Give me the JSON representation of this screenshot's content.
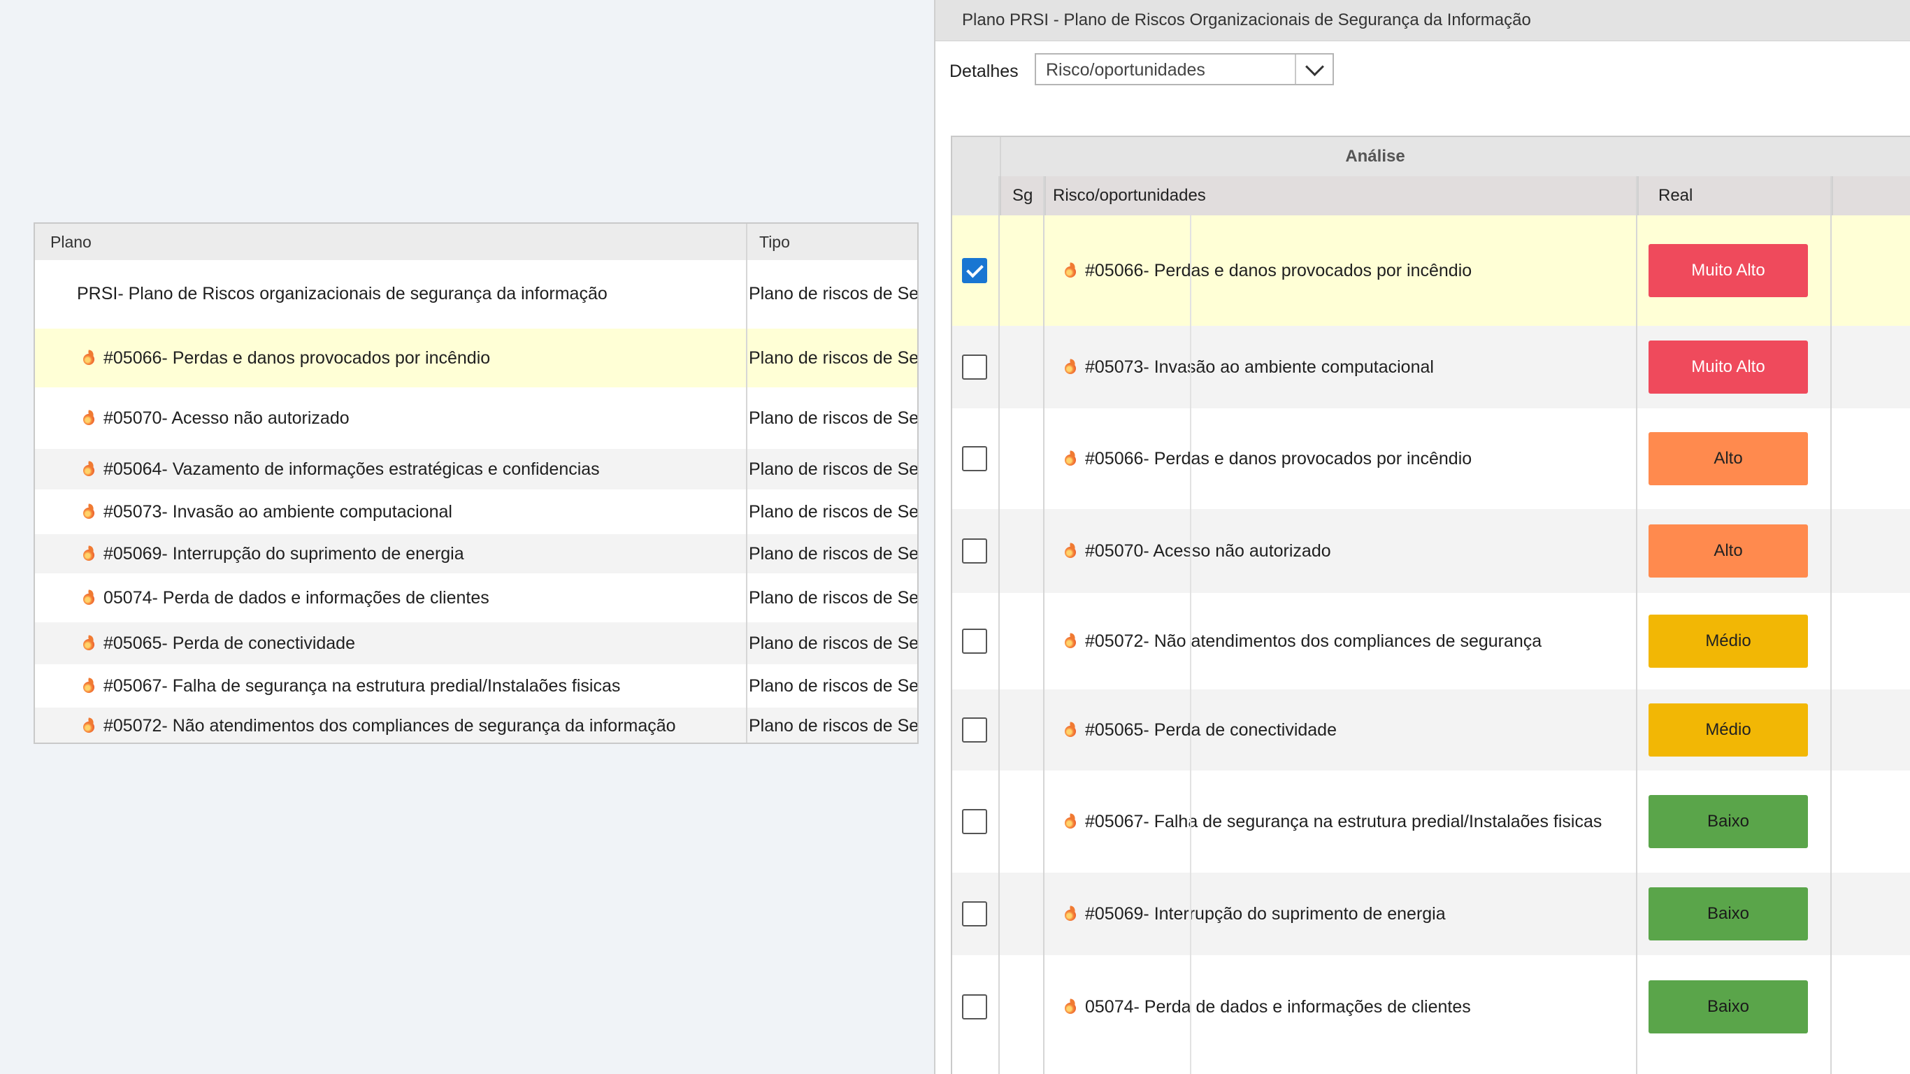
{
  "left_grid": {
    "columns": {
      "plano": "Plano",
      "tipo": "Tipo"
    },
    "rows": [
      {
        "plano": "PRSI- Plano de Riscos organizacionais de segurança da informação",
        "tipo": "Plano de riscos de Se",
        "icon": "",
        "indent": 0
      },
      {
        "plano": "#05066- Perdas e danos provocados por incêndio",
        "tipo": "Plano de riscos de Se",
        "icon": "flame-icon",
        "indent": 1,
        "highlight": true
      },
      {
        "plano": "#05070- Acesso não autorizado",
        "tipo": "Plano de riscos de Se",
        "icon": "flame-icon",
        "indent": 1
      },
      {
        "plano": "#05064- Vazamento de informações estratégicas e confidencias",
        "tipo": "Plano de riscos de Se",
        "icon": "flame-icon",
        "indent": 1
      },
      {
        "plano": "#05073- Invasão ao ambiente computacional",
        "tipo": "Plano de riscos de Se",
        "icon": "flame-icon",
        "indent": 1
      },
      {
        "plano": "#05069- Interrupção do suprimento de energia",
        "tipo": "Plano de riscos de Se",
        "icon": "flame-icon",
        "indent": 1
      },
      {
        "plano": "05074- Perda de dados e informações de clientes",
        "tipo": "Plano de riscos de Se",
        "icon": "flame-icon",
        "indent": 1
      },
      {
        "plano": "#05065- Perda de conectividade",
        "tipo": "Plano de riscos de Se",
        "icon": "flame-icon",
        "indent": 1
      },
      {
        "plano": "#05067- Falha de segurança na estrutura predial/Instalaões fisicas",
        "tipo": "Plano de riscos de Se",
        "icon": "flame-icon",
        "indent": 1
      },
      {
        "plano": "#05072-  Não atendimentos  dos compliances de segurança da informação",
        "tipo": "Plano de riscos de Se",
        "icon": "flame-icon",
        "indent": 1
      }
    ]
  },
  "window": {
    "title": "Plano PRSI - Plano de Riscos Organizacionais de Segurança da Informação",
    "detalhes_label": "Detalhes",
    "select_value": "Risco/oportunidades",
    "grid": {
      "group_header": "Análise",
      "columns": {
        "sg": "Sg",
        "risco": "Risco/oportunidades",
        "real": "Real"
      },
      "rows": [
        {
          "checked": true,
          "text": "#05066- Perdas e danos provocados por incêndio",
          "real": "Muito Alto",
          "level": "muito-alto",
          "highlight": true
        },
        {
          "checked": false,
          "text": "#05073- Invasão ao ambiente computacional",
          "real": "Muito Alto",
          "level": "muito-alto"
        },
        {
          "checked": false,
          "text": "#05066- Perdas e danos provocados por incêndio",
          "real": "Alto",
          "level": "alto"
        },
        {
          "checked": false,
          "text": "#05070- Acesso não autorizado",
          "real": "Alto",
          "level": "alto"
        },
        {
          "checked": false,
          "text": "#05072-  Não atendimentos  dos compliances de segurança",
          "real": "Médio",
          "level": "medio"
        },
        {
          "checked": false,
          "text": "#05065- Perda de conectividade",
          "real": "Médio",
          "level": "medio"
        },
        {
          "checked": false,
          "text": "#05067- Falha de segurança na estrutura predial/Instalaões fisicas",
          "real": "Baixo",
          "level": "baixo"
        },
        {
          "checked": false,
          "text": "#05069- Interrupção do suprimento de energia",
          "real": "Baixo",
          "level": "baixo"
        },
        {
          "checked": false,
          "text": "05074- Perda de dados e informações de clientes",
          "real": "Baixo",
          "level": "baixo"
        }
      ]
    }
  },
  "colors": {
    "highlight_row": "#ffffd6",
    "alt_row": "#f3f3f3",
    "muito_alto": "#ef4a5c",
    "alto": "#ff8a4e",
    "medio": "#f2b705",
    "baixo": "#5aa54a",
    "checkbox_checked": "#1976d2"
  }
}
